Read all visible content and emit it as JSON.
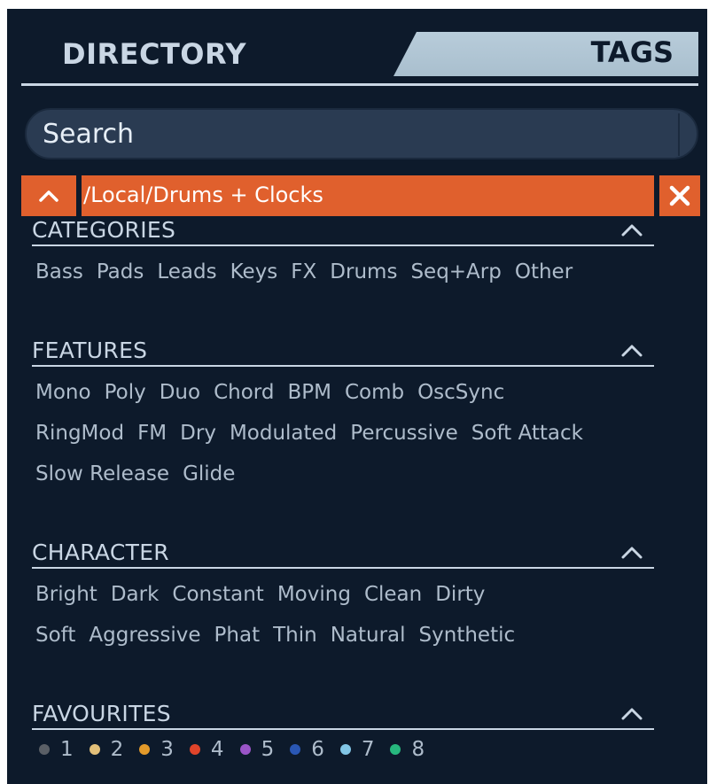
{
  "tabs": {
    "directory": "DIRECTORY",
    "tags": "TAGS"
  },
  "search": {
    "placeholder": "Search"
  },
  "path": {
    "label": "/Local/Drums + Clocks"
  },
  "sections": {
    "categories": {
      "title": "CATEGORIES",
      "rows": [
        [
          "Bass",
          "Pads",
          "Leads",
          "Keys",
          "FX",
          "Drums",
          "Seq+Arp",
          "Other"
        ]
      ]
    },
    "features": {
      "title": "FEATURES",
      "rows": [
        [
          "Mono",
          "Poly",
          "Duo",
          "Chord",
          "BPM",
          "Comb",
          "OscSync"
        ],
        [
          "RingMod",
          "FM",
          "Dry",
          "Modulated",
          "Percussive",
          "Soft Attack"
        ],
        [
          "Slow Release",
          "Glide"
        ]
      ]
    },
    "character": {
      "title": "CHARACTER",
      "rows": [
        [
          "Bright",
          "Dark",
          "Constant",
          "Moving",
          "Clean",
          "Dirty"
        ],
        [
          "Soft",
          "Aggressive",
          "Phat",
          "Thin",
          "Natural",
          "Synthetic"
        ]
      ]
    },
    "favourites": {
      "title": "FAVOURITES",
      "items": [
        {
          "label": "1",
          "color": "#5a5f66"
        },
        {
          "label": "2",
          "color": "#e3c07a"
        },
        {
          "label": "3",
          "color": "#e39a2a"
        },
        {
          "label": "4",
          "color": "#e0442a"
        },
        {
          "label": "5",
          "color": "#9a55c8"
        },
        {
          "label": "6",
          "color": "#2a57b4"
        },
        {
          "label": "7",
          "color": "#82c6e6"
        },
        {
          "label": "8",
          "color": "#27b87e"
        }
      ]
    }
  },
  "colors": {
    "accent": "#e0602d",
    "background": "#0d1a2b",
    "text": "#aebccb"
  }
}
